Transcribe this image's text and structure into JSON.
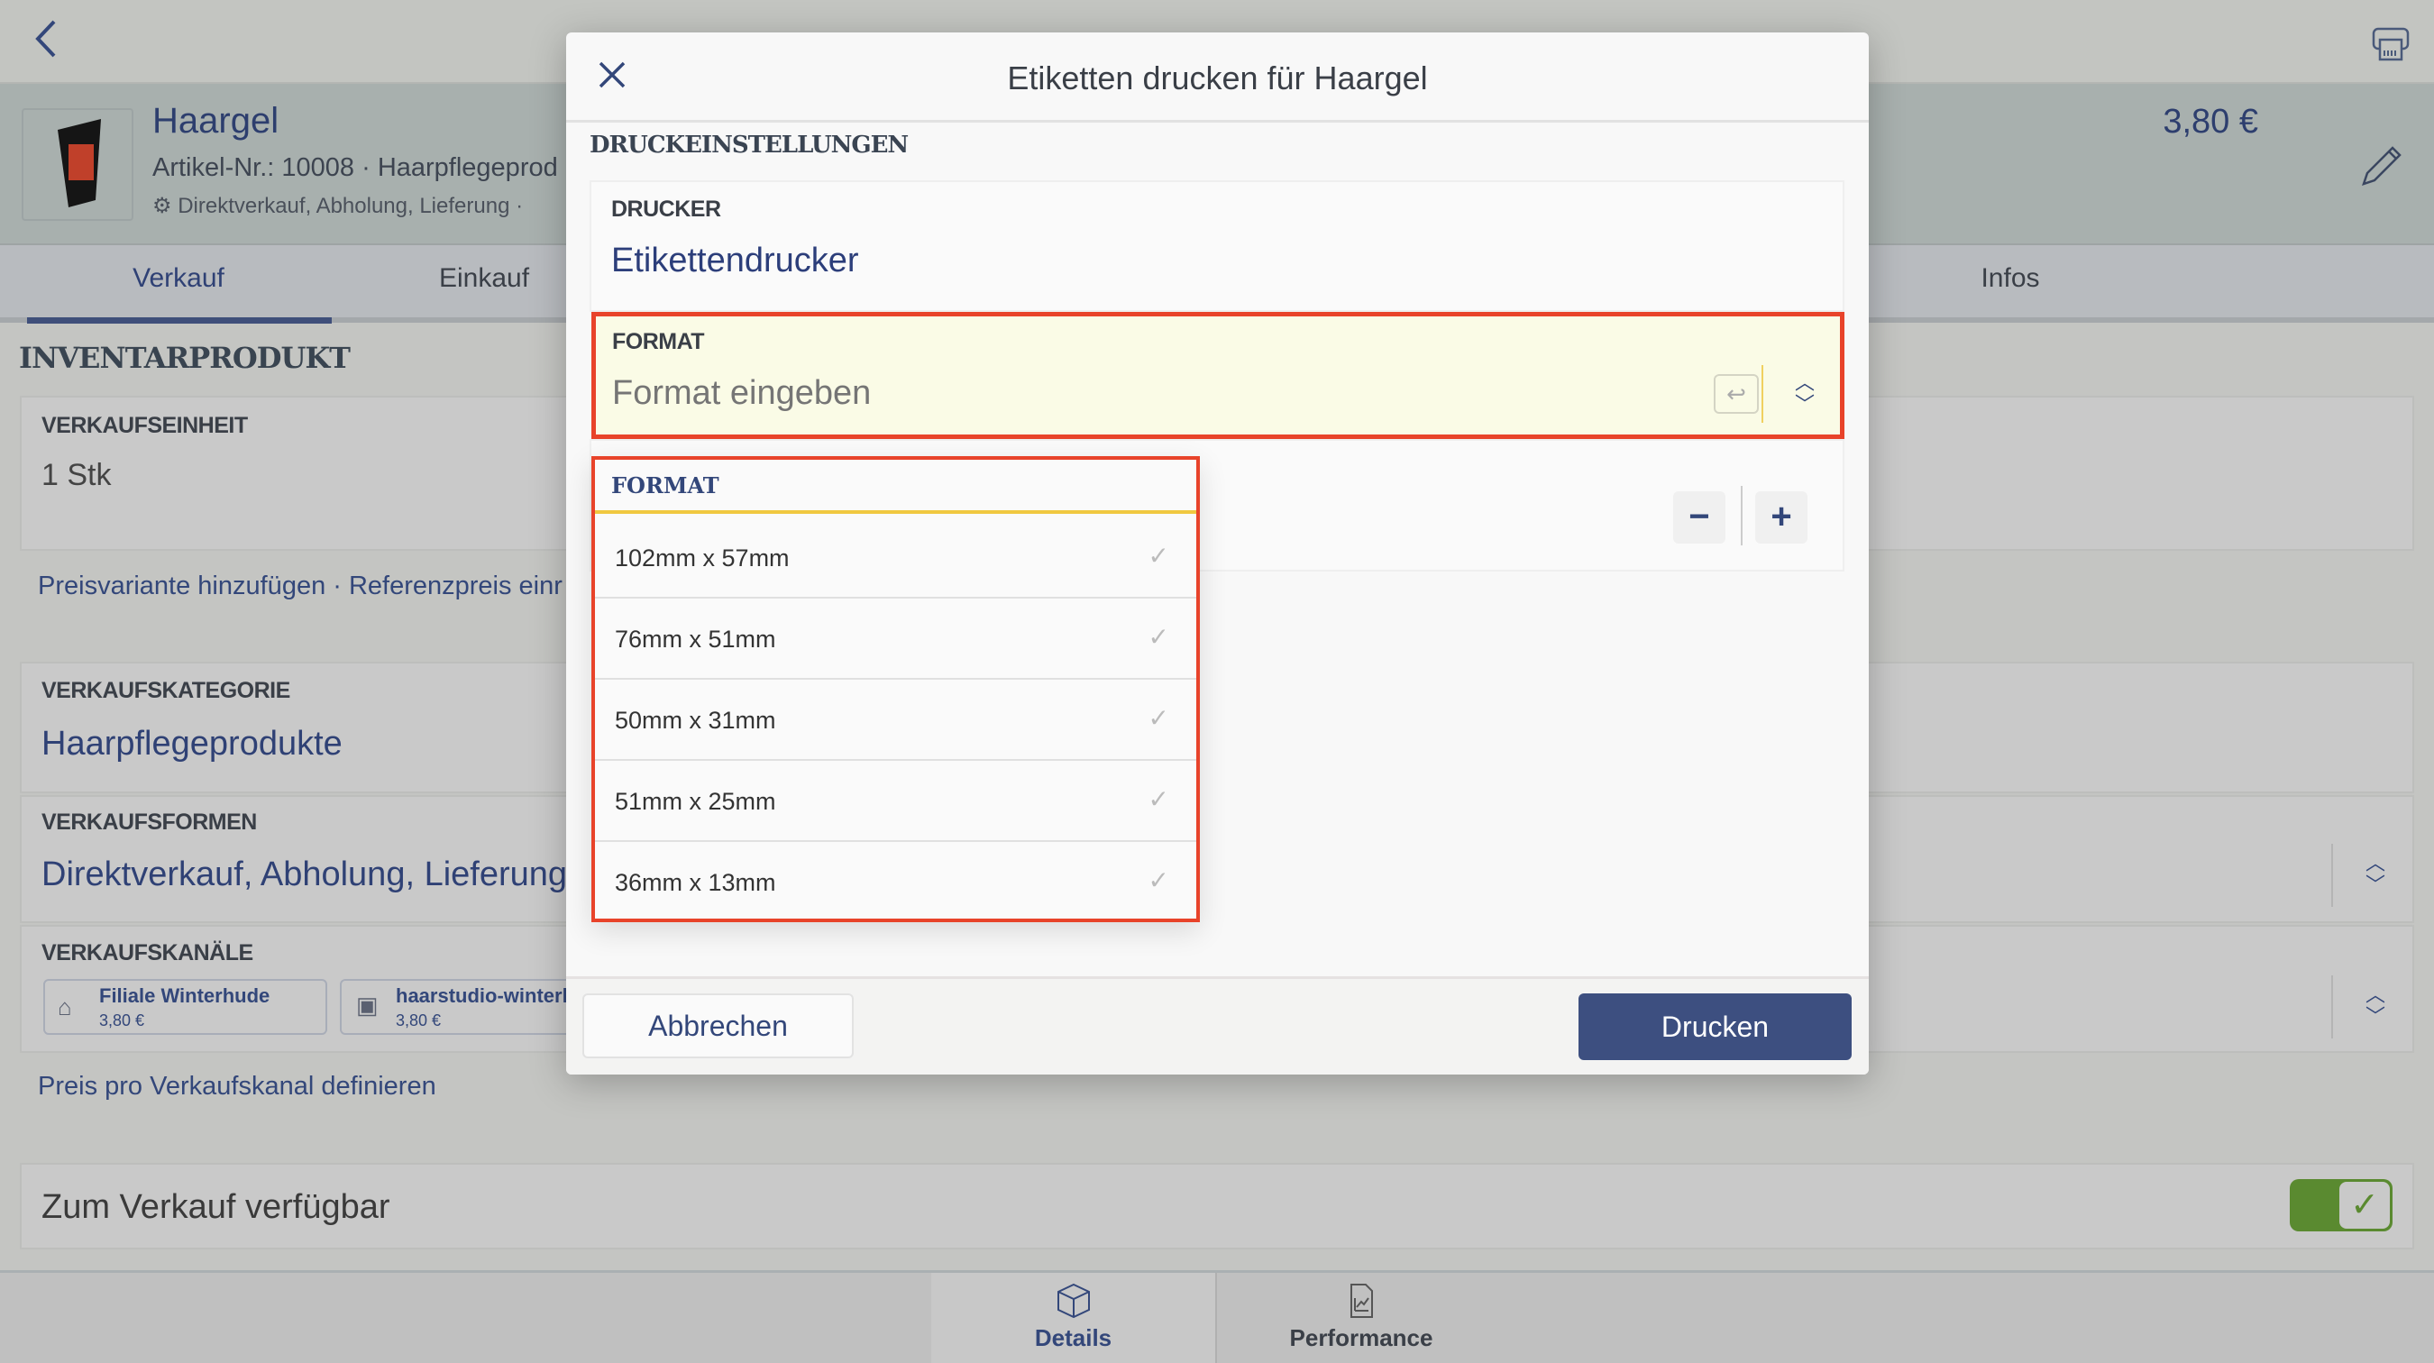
{
  "topbar": {
    "back_icon": "chevron-left-icon",
    "printer_icon": "label-printer-icon"
  },
  "product": {
    "name": "Haargel",
    "article_line": "Artikel-Nr.: 10008 · Haarpflegeprod",
    "sales_line": "Direktverkauf, Abholung, Lieferung ·",
    "price": "3,80 €",
    "edit_icon": "pencil-icon"
  },
  "tabs": [
    {
      "label": "Verkauf",
      "active": true
    },
    {
      "label": "Einkauf"
    },
    {
      "label": "Infos"
    }
  ],
  "main": {
    "section_title": "INVENTARPRODUKT",
    "unit_label": "VERKAUFSEINHEIT",
    "unit_value": "1 Stk",
    "links": "Preisvariante hinzufügen · Referenzpreis einr",
    "category_label": "VERKAUFSKATEGORIE",
    "category_value": "Haarpflegeprodukte",
    "forms_label": "VERKAUFSFORMEN",
    "forms_value": "Direktverkauf, Abholung, Lieferung",
    "channels_label": "VERKAUFSKANÄLE",
    "channels": [
      {
        "name": "Filiale Winterhude",
        "price": "3,80 €"
      },
      {
        "name": "haarstudio-winterh",
        "price": "3,80 €"
      }
    ],
    "channel_price_link": "Preis pro Verkaufskanal definieren",
    "available_label": "Zum Verkauf verfügbar",
    "available_on": true
  },
  "bottom_nav": [
    {
      "label": "Details",
      "icon": "box-icon",
      "active": true
    },
    {
      "label": "Performance",
      "icon": "chart-document-icon"
    }
  ],
  "dialog": {
    "title": "Etiketten drucken für Haargel",
    "section": "DRUCKEINSTELLUNGEN",
    "printer_label": "DRUCKER",
    "printer_value": "Etikettendrucker",
    "format_label": "FORMAT",
    "format_placeholder": "Format eingeben",
    "minus": "−",
    "plus": "+",
    "dropdown": {
      "header": "FORMAT",
      "options": [
        "102mm x 57mm",
        "76mm x 51mm",
        "50mm x 31mm",
        "51mm x 25mm",
        "36mm x 13mm"
      ]
    },
    "cancel": "Abbrechen",
    "print": "Drucken"
  },
  "colors": {
    "accent": "#3d4f80",
    "highlight_border": "#e8432a",
    "field_bg": "#fafbe6",
    "toggle": "#5a8a30"
  }
}
